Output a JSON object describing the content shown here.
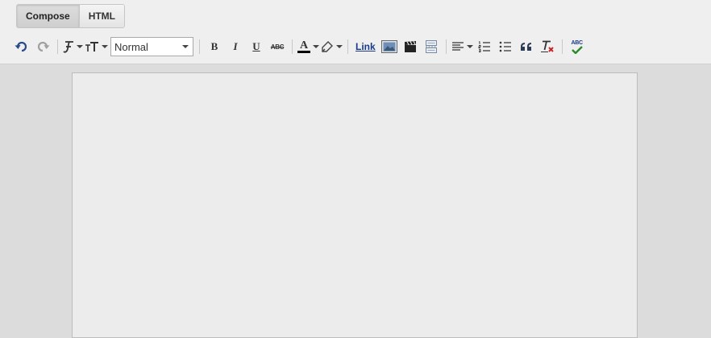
{
  "mode_tabs": [
    {
      "label": "Compose",
      "active": true
    },
    {
      "label": "HTML",
      "active": false
    }
  ],
  "toolbar": {
    "undo_icon": "undo-icon",
    "redo_icon": "redo-icon",
    "font_icon": "font-family-icon",
    "font_size_icon": "font-size-icon",
    "format_select_value": "Normal",
    "bold_label": "B",
    "italic_label": "I",
    "underline_label": "U",
    "strike_label": "ABC",
    "text_color_label": "A",
    "text_color": "#000000",
    "link_label": "Link",
    "spellcheck_label": "ABC"
  },
  "colors": {
    "link": "#1a3a8a",
    "spellcheck_check": "#2a8a2a",
    "remove_format_x": "#cc2222",
    "editor_bg": "#ececec",
    "page_bg": "#dcdcdc"
  }
}
